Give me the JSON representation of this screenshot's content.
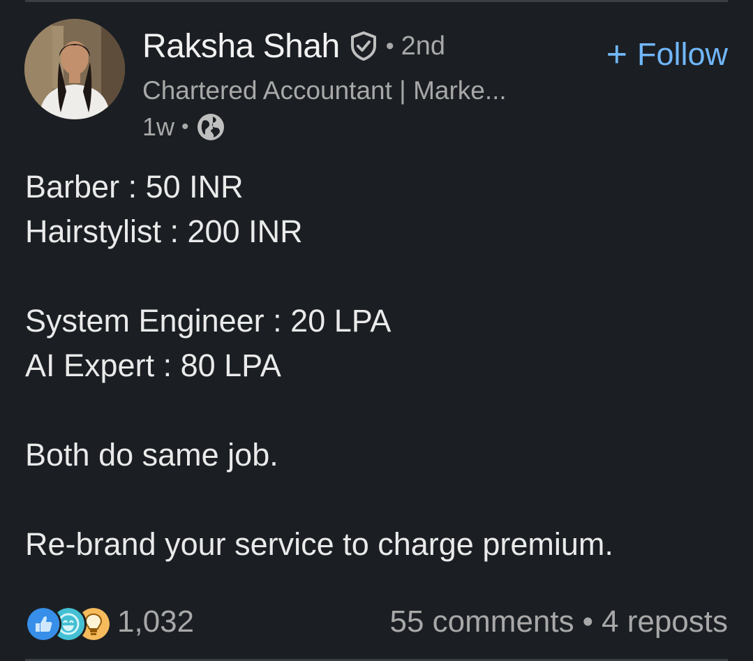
{
  "author": {
    "name": "Raksha Shah",
    "degree": "2nd",
    "headline": "Chartered Accountant | Marke...",
    "time": "1w",
    "verified_icon": "verified-shield-icon",
    "visibility_icon": "globe-icon"
  },
  "follow_button": {
    "plus": "+",
    "label": "Follow"
  },
  "separators": {
    "dot": "•"
  },
  "post": {
    "lines": [
      "Barber : 50 INR",
      "Hairstylist : 200 INR",
      "System Engineer : 20 LPA",
      "AI Expert : 80 LPA",
      "Both do same job.",
      "Re-brand your service to charge premium."
    ]
  },
  "social": {
    "reaction_icons": [
      "like-icon",
      "funny-icon",
      "insightful-icon"
    ],
    "reaction_count": "1,032",
    "comments": "55 comments",
    "reposts": "4 reposts"
  },
  "colors": {
    "background": "#1b1f23",
    "accent": "#71b7fb",
    "secondary_text": "#a8a8a8",
    "primary_text": "#eaeaea"
  }
}
